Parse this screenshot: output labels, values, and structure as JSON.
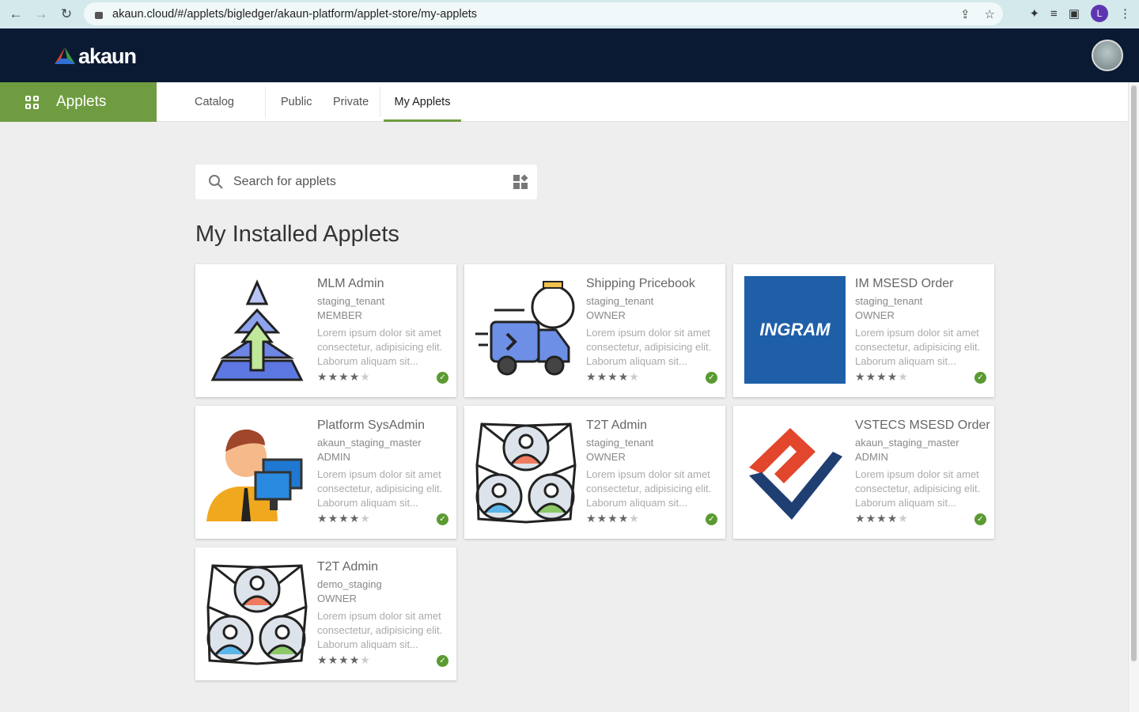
{
  "browser": {
    "url": "akaun.cloud/#/applets/bigledger/akaun-platform/applet-store/my-applets",
    "profile_initial": "L"
  },
  "header": {
    "logo_text": "akaun"
  },
  "nav": {
    "applets_label": "Applets",
    "tabs": [
      {
        "label": "Catalog"
      },
      {
        "label": "Public"
      },
      {
        "label": "Private"
      },
      {
        "label": "My Applets",
        "active": true
      }
    ]
  },
  "search": {
    "placeholder": "Search for applets",
    "value": ""
  },
  "section_title": "My Installed Applets",
  "colors": {
    "accent": "#6f9c40",
    "header": "#0b1a33",
    "installed": "#5b9a32"
  },
  "applets": [
    {
      "title": "MLM Admin",
      "tenant": "staging_tenant",
      "role": "MEMBER",
      "description": "Lorem ipsum dolor sit amet consectetur, adipisicing elit. Laborum aliquam sit...",
      "rating": 4,
      "icon": "pyramid-arrow-icon",
      "installed": true
    },
    {
      "title": "Shipping Pricebook",
      "tenant": "staging_tenant",
      "role": "OWNER",
      "description": "Lorem ipsum dolor sit amet consectetur, adipisicing elit. Laborum aliquam sit...",
      "rating": 4,
      "icon": "delivery-truck-icon",
      "installed": true
    },
    {
      "title": "IM MSESD Order",
      "tenant": "staging_tenant",
      "role": "OWNER",
      "description": "Lorem ipsum dolor sit amet consectetur, adipisicing elit. Laborum aliquam sit...",
      "rating": 4,
      "icon": "ingram-logo",
      "logo_text": "INGRAM",
      "installed": true
    },
    {
      "title": "Platform SysAdmin",
      "tenant": "akaun_staging_master",
      "role": "ADMIN",
      "description": "Lorem ipsum dolor sit amet consectetur, adipisicing elit. Laborum aliquam sit...",
      "rating": 4,
      "icon": "sysadmin-person-icon",
      "installed": true
    },
    {
      "title": "T2T Admin",
      "tenant": "staging_tenant",
      "role": "OWNER",
      "description": "Lorem ipsum dolor sit amet consectetur, adipisicing elit. Laborum aliquam sit...",
      "rating": 4,
      "icon": "network-people-icon",
      "installed": true
    },
    {
      "title": "VSTECS MSESD Order",
      "tenant": "akaun_staging_master",
      "role": "ADMIN",
      "description": "Lorem ipsum dolor sit amet consectetur, adipisicing elit. Laborum aliquam sit...",
      "rating": 4,
      "icon": "vstecs-logo",
      "installed": true
    },
    {
      "title": "T2T Admin",
      "tenant": "demo_staging",
      "role": "OWNER",
      "description": "Lorem ipsum dolor sit amet consectetur, adipisicing elit. Laborum aliquam sit...",
      "rating": 4,
      "icon": "network-people-icon",
      "installed": true
    }
  ]
}
